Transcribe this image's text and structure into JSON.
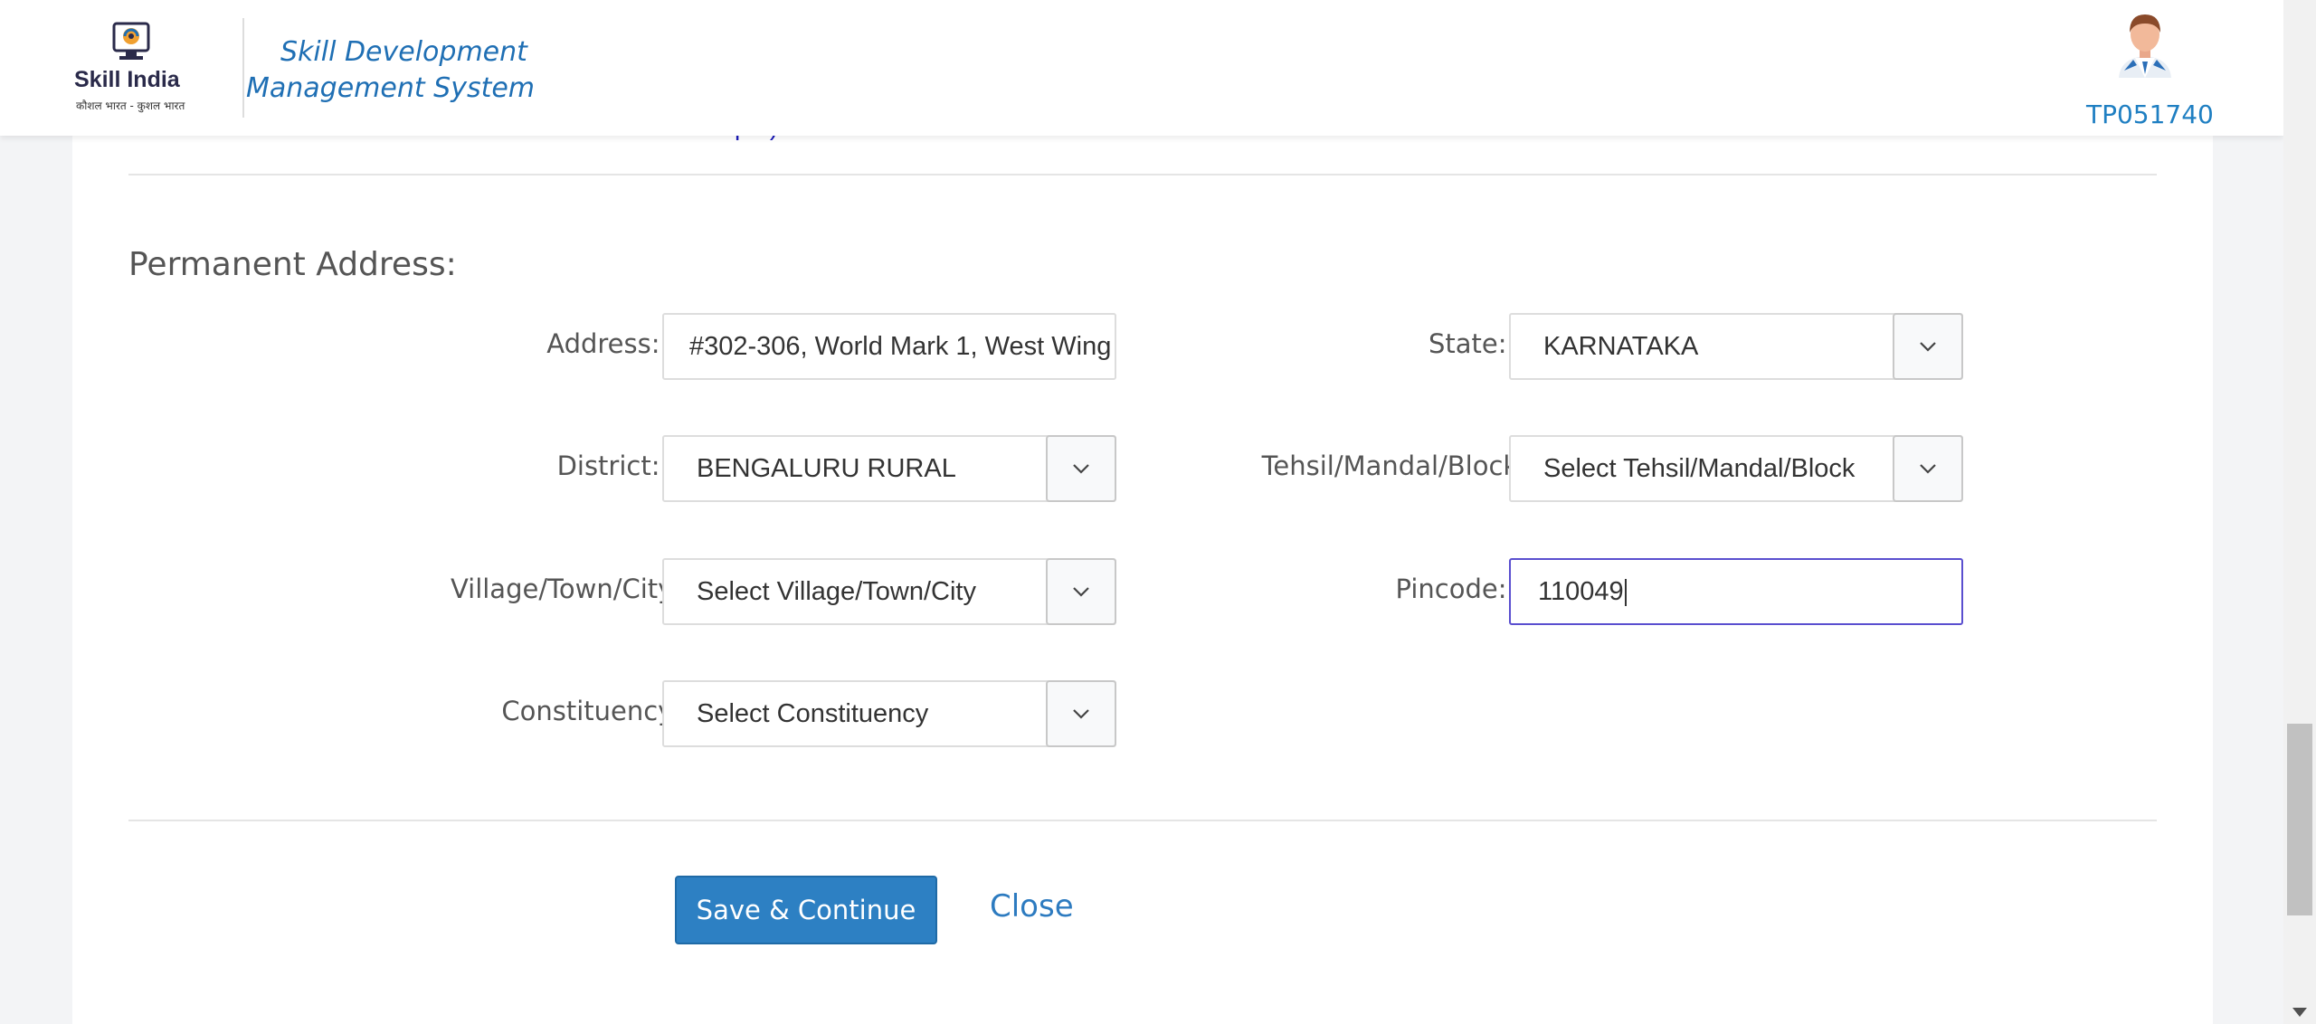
{
  "header": {
    "logo_title": "Skill India",
    "logo_tagline": "कौशल भारत - कुशल भारत",
    "app_title": "Skill Development Management System",
    "user_id": "TP051740"
  },
  "partial_text": "pdf)",
  "form": {
    "section_title": "Permanent Address:",
    "required_marker": "*",
    "address": {
      "label": "Address:",
      "value": "#302-306, World Mark 1, West Wing"
    },
    "state": {
      "label": "State:",
      "value": "KARNATAKA"
    },
    "district": {
      "label": "District:",
      "value": "BENGALURU RURAL"
    },
    "tehsil": {
      "label": "Tehsil/Mandal/Block:",
      "value": "Select Tehsil/Mandal/Block"
    },
    "village": {
      "label": "Village/Town/City:",
      "value": "Select Village/Town/City"
    },
    "pincode": {
      "label": "Pincode:",
      "value": "110049"
    },
    "constituency": {
      "label": "Constituency:",
      "value": "Select Constituency"
    }
  },
  "actions": {
    "save_label": "Save & Continue",
    "close_label": "Close"
  },
  "colors": {
    "brand_blue": "#2d80c3",
    "required_red": "#e02020",
    "focus_border": "#5a4fcf"
  }
}
